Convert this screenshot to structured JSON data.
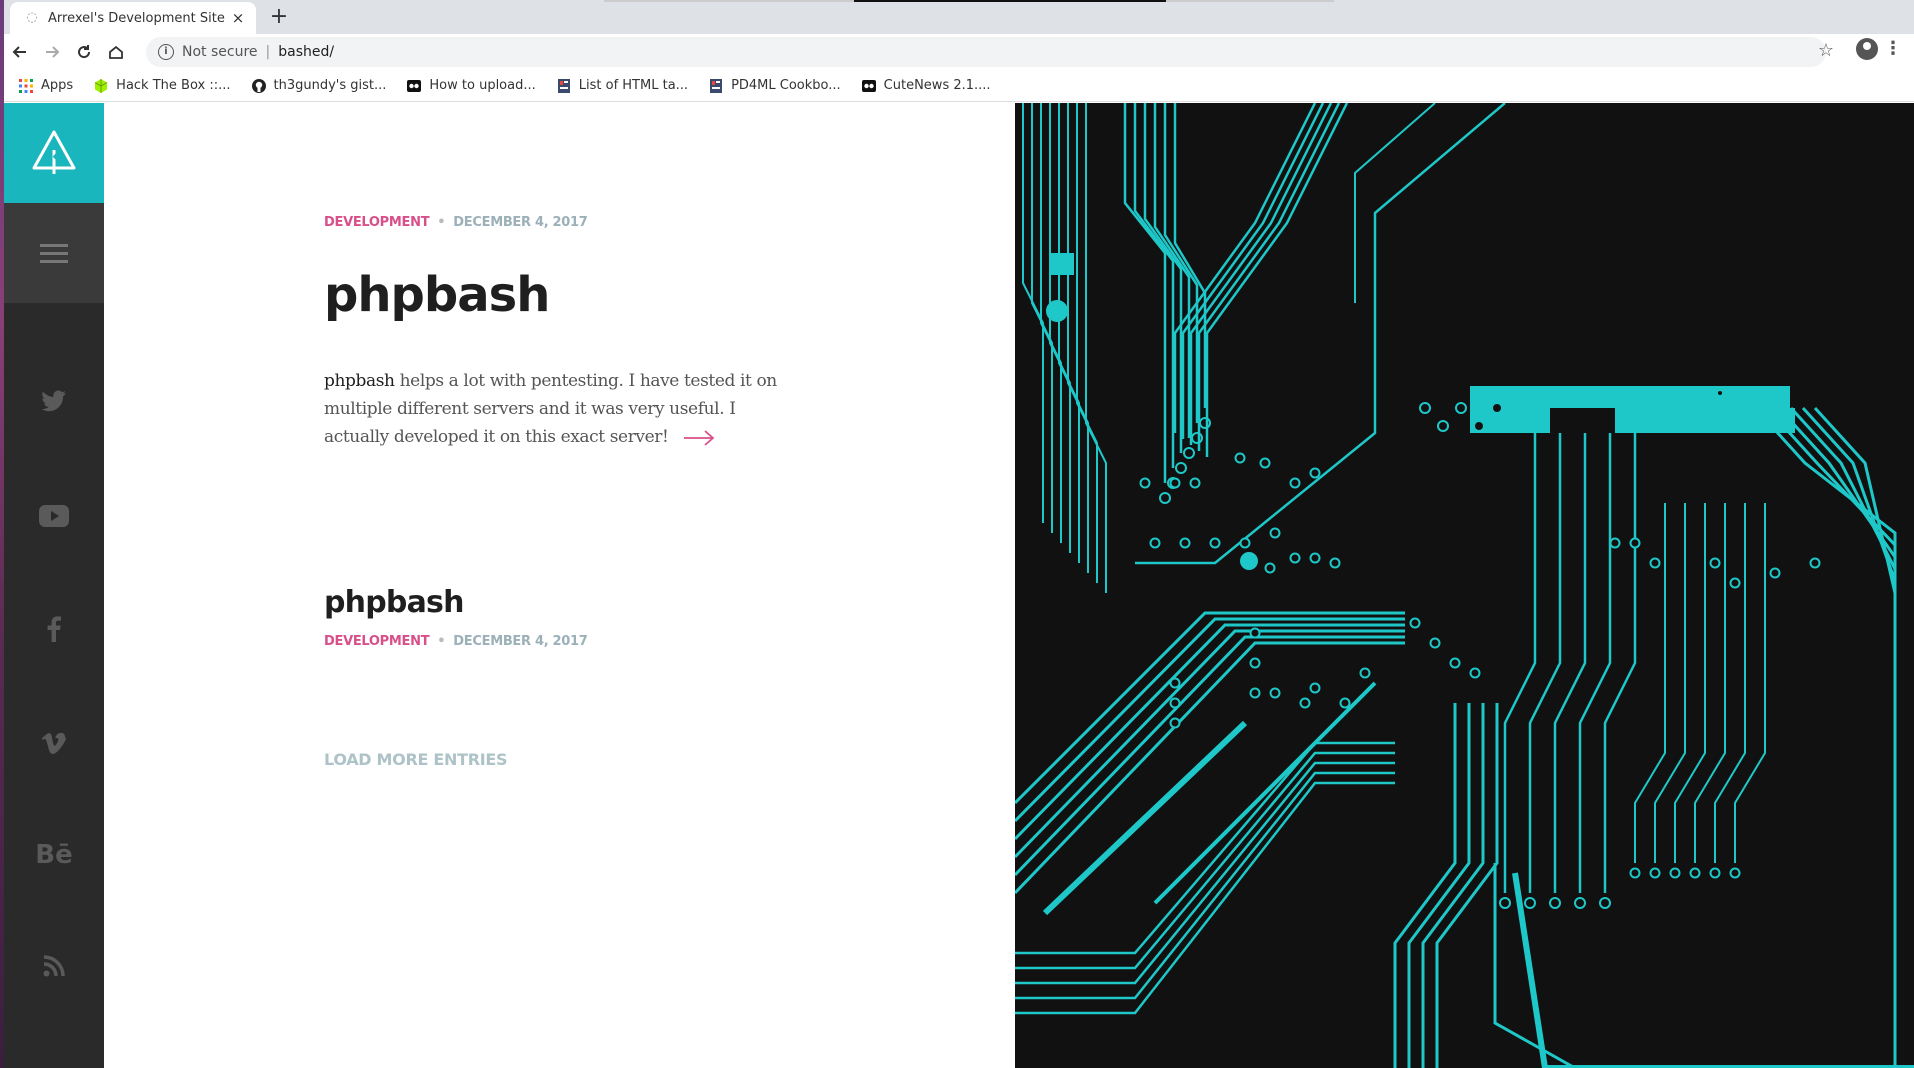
{
  "browser": {
    "tab_title": "Arrexel's Development Site",
    "new_tab_glyph": "+",
    "close_glyph": "×",
    "not_secure": "Not secure",
    "url": "bashed/",
    "bookmarks": [
      {
        "label": "Apps",
        "icon": "apps-grid-icon"
      },
      {
        "label": "Hack The Box ::...",
        "icon": "htb-cube-icon"
      },
      {
        "label": "th3gundy's gist...",
        "icon": "github-icon"
      },
      {
        "label": "How to upload...",
        "icon": "site-icon"
      },
      {
        "label": "List of HTML ta...",
        "icon": "page-icon"
      },
      {
        "label": "PD4ML Cookbo...",
        "icon": "page-icon"
      },
      {
        "label": "CuteNews 2.1....",
        "icon": "site-icon"
      }
    ]
  },
  "sidebar": {
    "social": [
      "twitter-icon",
      "youtube-icon",
      "facebook-icon",
      "vimeo-icon",
      "behance-icon",
      "rss-icon"
    ],
    "behance_text": "Bē"
  },
  "posts": [
    {
      "category": "DEVELOPMENT",
      "date": "DECEMBER 4, 2017",
      "title": "phpbash",
      "excerpt_lead": "phpbash",
      "excerpt_rest": " helps a lot with pentesting. I have tested it on multiple different servers and it was very useful. I actually developed it on this exact server!"
    },
    {
      "title": "phpbash",
      "category": "DEVELOPMENT",
      "date": "DECEMBER 4, 2017"
    }
  ],
  "load_more": "LOAD MORE ENTRIES",
  "colors": {
    "accent": "#1ab6be",
    "category": "#d94f8a",
    "sidebar": "#2a2a2a",
    "hero_bg": "#111111",
    "circuit": "#1fc8c8"
  }
}
